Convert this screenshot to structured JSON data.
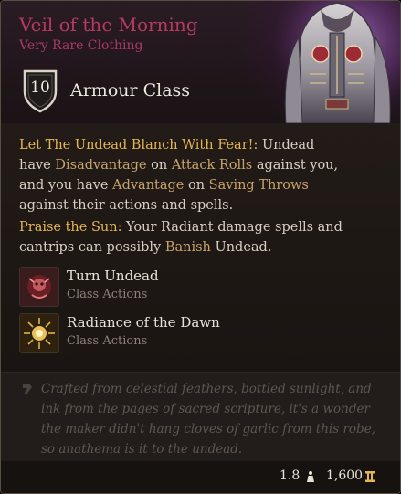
{
  "item": {
    "name": "Veil of the Morning",
    "rarity": "Very Rare Clothing",
    "armour_class_value": "10",
    "armour_class_label": "Armour Class"
  },
  "passives": [
    {
      "title": "Let The Undead Blanch With Fear!:",
      "text1": " Undead have ",
      "kw1": "Disadvantage",
      "text2": " on ",
      "kw2": "Attack Rolls",
      "text3": " against you, and you have ",
      "kw3": "Advantage",
      "text4": " on ",
      "kw4": "Saving Throws",
      "text5": " against their actions and spells."
    },
    {
      "title": "Praise the Sun:",
      "text1": " Your Radiant damage spells and cantrips can possibly ",
      "kw1": "Banish",
      "text2": " Undead."
    }
  ],
  "actions": [
    {
      "name": "Turn Undead",
      "category": "Class Actions",
      "icon": "turn-undead-icon"
    },
    {
      "name": "Radiance of the Dawn",
      "category": "Class Actions",
      "icon": "radiance-icon"
    }
  ],
  "flavor": "Crafted from celestial feathers, bottled sunlight, and ink from the pages of sacred scripture, it's a wonder the maker didn't hang cloves of garlic from this robe, so anathema is it to the undead.",
  "footer": {
    "weight": "1.8",
    "price": "1,600"
  },
  "colors": {
    "title": "#b53a62",
    "rarity": "#a8396a",
    "highlight": "#e4b653",
    "keyword": "#c9a36d",
    "text": "#d8cfc3",
    "muted": "#8d8278",
    "flavor": "#5f564f"
  }
}
